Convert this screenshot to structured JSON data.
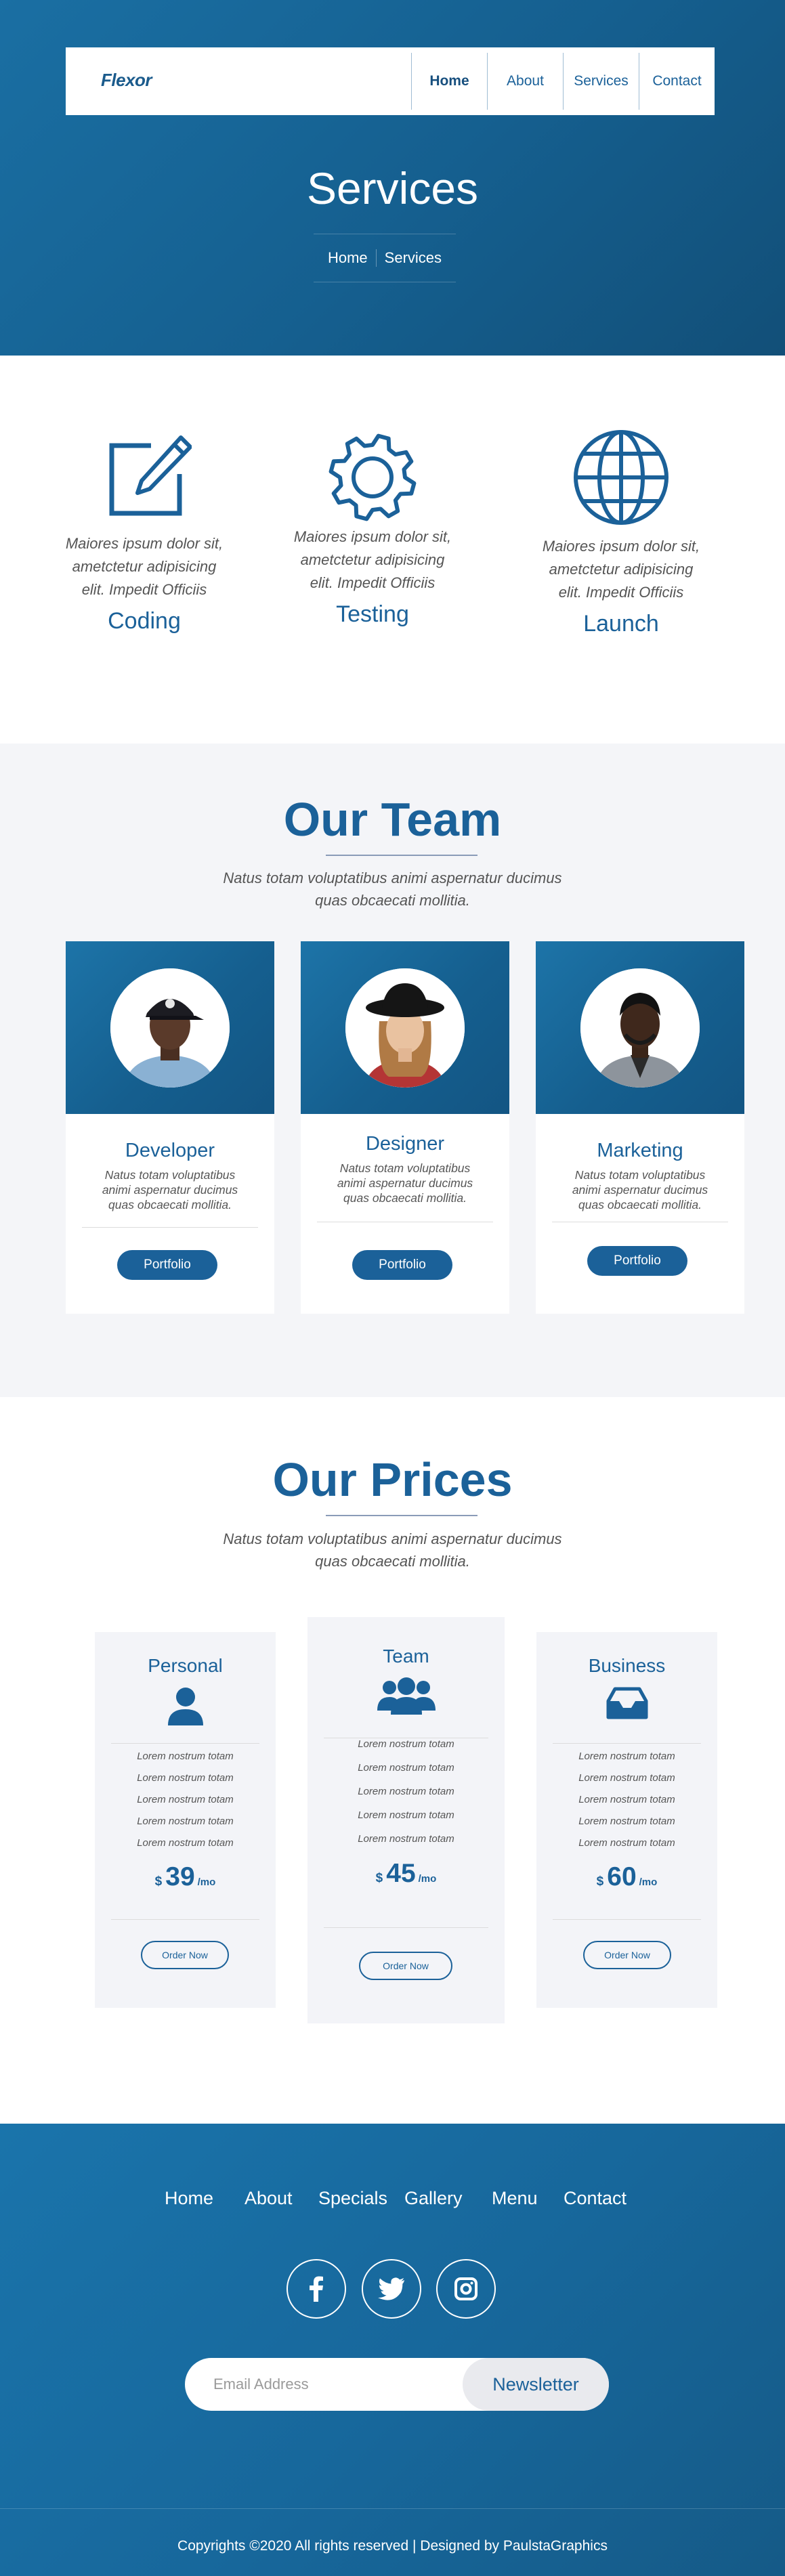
{
  "nav": {
    "logo": "Flexor",
    "links": [
      "Home",
      "About",
      "Services",
      "Contact"
    ]
  },
  "hero": {
    "title": "Services",
    "breadcrumb": [
      "Home",
      "Services"
    ]
  },
  "services": [
    {
      "icon": "edit-icon",
      "desc_lines": [
        "Maiores ipsum dolor sit,",
        "ametctetur adipisicing",
        "elit. Impedit Officiis"
      ],
      "name": "Coding"
    },
    {
      "icon": "gear-icon",
      "desc_lines": [
        "Maiores ipsum dolor sit,",
        "ametctetur adipisicing",
        "elit. Impedit Officiis"
      ],
      "name": "Testing"
    },
    {
      "icon": "globe-icon",
      "desc_lines": [
        "Maiores ipsum dolor sit,",
        "ametctetur adipisicing",
        "elit. Impedit Officiis"
      ],
      "name": "Launch"
    }
  ],
  "team": {
    "title": "Our Team",
    "subtitle_lines": [
      "Natus totam voluptatibus animi aspernatur ducimus",
      "quas obcaecati mollitia."
    ],
    "members": [
      {
        "role": "Developer",
        "desc_lines": [
          "Natus totam voluptatibus",
          "animi aspernatur ducimus",
          "quas obcaecati mollitia."
        ],
        "button": "Portfolio"
      },
      {
        "role": "Designer",
        "desc_lines": [
          "Natus totam voluptatibus",
          "animi aspernatur ducimus",
          "quas obcaecati mollitia."
        ],
        "button": "Portfolio"
      },
      {
        "role": "Marketing",
        "desc_lines": [
          "Natus totam voluptatibus",
          "animi aspernatur ducimus",
          "quas obcaecati mollitia."
        ],
        "button": "Portfolio"
      }
    ]
  },
  "prices": {
    "title": "Our Prices",
    "subtitle_lines": [
      "Natus totam voluptatibus animi aspernatur ducimus",
      "quas obcaecati mollitia."
    ],
    "plans": [
      {
        "name": "Personal",
        "icon": "user-icon",
        "features": [
          "Lorem nostrum totam",
          "Lorem nostrum totam",
          "Lorem nostrum totam",
          "Lorem nostrum totam",
          "Lorem nostrum totam"
        ],
        "currency": "$",
        "amount": "39",
        "period": "/mo",
        "button": "Order Now"
      },
      {
        "name": "Team",
        "icon": "users-icon",
        "features": [
          "Lorem nostrum totam",
          "Lorem nostrum totam",
          "Lorem nostrum totam",
          "Lorem nostrum totam",
          "Lorem nostrum totam"
        ],
        "currency": "$",
        "amount": "45",
        "period": "/mo",
        "button": "Order Now"
      },
      {
        "name": "Business",
        "icon": "inbox-icon",
        "features": [
          "Lorem nostrum totam",
          "Lorem nostrum totam",
          "Lorem nostrum totam",
          "Lorem nostrum totam",
          "Lorem nostrum totam"
        ],
        "currency": "$",
        "amount": "60",
        "period": "/mo",
        "button": "Order Now"
      }
    ]
  },
  "footer": {
    "links": [
      "Home",
      "About",
      "Specials",
      "Gallery",
      "Menu",
      "Contact"
    ],
    "social": [
      "facebook-icon",
      "twitter-icon",
      "instagram-icon"
    ],
    "newsletter": {
      "placeholder": "Email Address",
      "button": "Newsletter"
    },
    "copyright": "Copyrights ©2020 All rights reserved | Designed by PaulstaGraphics"
  },
  "colors": {
    "brand": "#1b6199",
    "hero_gradient": [
      "#1a6fa3",
      "#124f78"
    ],
    "section_bg": "#f4f5f8",
    "plan_bg": "#f3f4f8"
  }
}
